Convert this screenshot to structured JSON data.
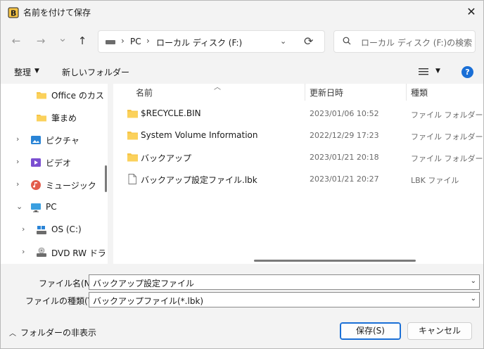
{
  "window": {
    "title": "名前を付けて保存",
    "close_symbol": "✕"
  },
  "nav": {
    "back_symbol": "←",
    "forward_symbol": "→",
    "recent_symbol": "⌄",
    "up_symbol": "↑",
    "breadcrumb": [
      "PC",
      "ローカル ディスク (F:)"
    ],
    "breadcrumb_sep": "›",
    "dropdown_symbol": "⌄",
    "refresh_symbol": "⟳",
    "search_placeholder": "ローカル ディスク (F:)の検索"
  },
  "commands": {
    "organize": "整理",
    "new_folder": "新しいフォルダー",
    "help": "?"
  },
  "sidebar": {
    "items": [
      {
        "label": "Office のカスタム",
        "icon": "folder-icon",
        "chevron": ""
      },
      {
        "label": "筆まめ",
        "icon": "folder-icon",
        "chevron": ""
      },
      {
        "label": "ピクチャ",
        "icon": "pictures-icon",
        "chevron": "›"
      },
      {
        "label": "ビデオ",
        "icon": "videos-icon",
        "chevron": "›"
      },
      {
        "label": "ミュージック",
        "icon": "music-icon",
        "chevron": "›"
      },
      {
        "label": "PC",
        "icon": "pc-icon",
        "chevron": "⌄"
      },
      {
        "label": "OS (C:)",
        "icon": "drive-icon",
        "chevron": "›"
      },
      {
        "label": "DVD RW ドライブ",
        "icon": "dvd-drive-icon",
        "chevron": "›"
      }
    ]
  },
  "filelist": {
    "columns": {
      "name": "名前",
      "date": "更新日時",
      "type": "種類"
    },
    "files": [
      {
        "name": "$RECYCLE.BIN",
        "date": "2023/01/06 10:52",
        "type": "ファイル フォルダー",
        "icon": "folder-icon"
      },
      {
        "name": "System Volume Information",
        "date": "2022/12/29 17:23",
        "type": "ファイル フォルダー",
        "icon": "folder-icon"
      },
      {
        "name": "バックアップ",
        "date": "2023/01/21 20:18",
        "type": "ファイル フォルダー",
        "icon": "folder-icon"
      },
      {
        "name": "バックアップ設定ファイル.lbk",
        "date": "2023/01/21 20:27",
        "type": "LBK ファイル",
        "icon": "file-icon"
      }
    ]
  },
  "form": {
    "filename_label": "ファイル名(N):",
    "filename_value": "バックアップ設定ファイル",
    "filetype_label": "ファイルの種類(T):",
    "filetype_value": "バックアップファイル(*.lbk)",
    "hide_folders": "フォルダーの非表示",
    "save": "保存(S)",
    "cancel": "キャンセル"
  },
  "colors": {
    "accent": "#1a6fd6",
    "folder": "#f6c445"
  }
}
